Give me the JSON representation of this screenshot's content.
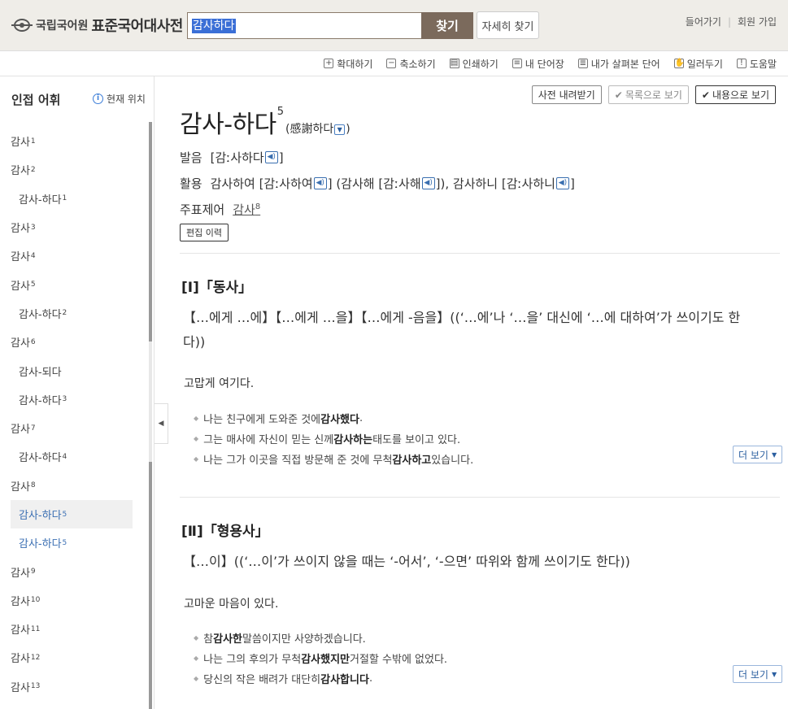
{
  "header": {
    "org": "국립국어원",
    "service": "표준국어대사전",
    "search_value": "감사하다",
    "search_button": "찾기",
    "detail_search": "자세히 찾기",
    "login": "들어가기",
    "join": "회원 가입"
  },
  "toolbar": {
    "zoom_in": "확대하기",
    "zoom_out": "축소하기",
    "print": "인쇄하기",
    "my_words": "내 단어장",
    "viewed": "내가 살펴본 단어",
    "report": "일러두기",
    "help": "도움말"
  },
  "sidebar": {
    "title": "인접 어휘",
    "location": "현재 위치",
    "items": [
      {
        "text": "감사",
        "sup": "1"
      },
      {
        "text": "감사",
        "sup": "2"
      },
      {
        "text": "감사-하다",
        "sup": "1"
      },
      {
        "text": "감사",
        "sup": "3"
      },
      {
        "text": "감사",
        "sup": "4"
      },
      {
        "text": "감사",
        "sup": "5"
      },
      {
        "text": "감사-하다",
        "sup": "2"
      },
      {
        "text": "감사",
        "sup": "6"
      },
      {
        "text": "감사-되다",
        "sup": ""
      },
      {
        "text": "감사-하다",
        "sup": "3"
      },
      {
        "text": "감사",
        "sup": "7"
      },
      {
        "text": "감사-하다",
        "sup": "4"
      },
      {
        "text": "감사",
        "sup": "8"
      },
      {
        "text": "감사-하다",
        "sup": "5"
      },
      {
        "text": "감사-하다",
        "sup": "5"
      },
      {
        "text": "감사",
        "sup": "9"
      },
      {
        "text": "감사",
        "sup": "10"
      },
      {
        "text": "감사",
        "sup": "11"
      },
      {
        "text": "감사",
        "sup": "12"
      },
      {
        "text": "감사",
        "sup": "13"
      }
    ]
  },
  "main": {
    "btn_download": "사전 내려받기",
    "btn_list": "목록으로 보기",
    "btn_content": "내용으로 보기",
    "headword": "감사-하다",
    "headword_sup": "5",
    "hanja": "(感謝하다",
    "hanja_close": ")",
    "pron_label": "발음",
    "pron": "[감ː사하다",
    "usage_label": "활용",
    "usage1": "감사하여 [감ː사하여",
    "usage2": "(감사해 [감ː사해",
    "usage3": "), 감사하니 [감ː사하니",
    "topic_label": "주표제어",
    "topic": "감사",
    "topic_sup": "8",
    "edit_history": "편집 이력",
    "sense1_title": "[Ⅰ]「동사」",
    "sense1_pattern": "【…에게 …에】【…에게 …을】【…에게 -음을】((‘…에’나 ‘…을’ 대신에 ‘…에 대하여’가 쓰이기도 한다))",
    "sense1_def": "고맙게 여기다.",
    "sense1_examples": [
      {
        "pre": "나는 친구에게 도와준 것에 ",
        "bold": "감사했다",
        "post": "."
      },
      {
        "pre": "그는 매사에 자신이 믿는 신께 ",
        "bold": "감사하는",
        "post": " 태도를 보이고 있다."
      },
      {
        "pre": "나는 그가 이곳을 직접 방문해 준 것에 무척 ",
        "bold": "감사하고",
        "post": " 있습니다."
      }
    ],
    "more": "더 보기",
    "sense2_title": "[Ⅱ]「형용사」",
    "sense2_pattern": "【…이】((‘…이’가 쓰이지 않을 때는 ‘-어서’, ‘-으면’ 따위와 함께 쓰이기도 한다))",
    "sense2_def": "고마운 마음이 있다.",
    "sense2_examples": [
      {
        "pre": "참 ",
        "bold": "감사한",
        "post": " 말씀이지만 사양하겠습니다."
      },
      {
        "pre": "나는 그의 후의가 무척 ",
        "bold": "감사했지만",
        "post": " 거절할 수밖에 없었다."
      },
      {
        "pre": "당신의 작은 배려가 대단히 ",
        "bold": "감사합니다",
        "post": "."
      }
    ]
  }
}
